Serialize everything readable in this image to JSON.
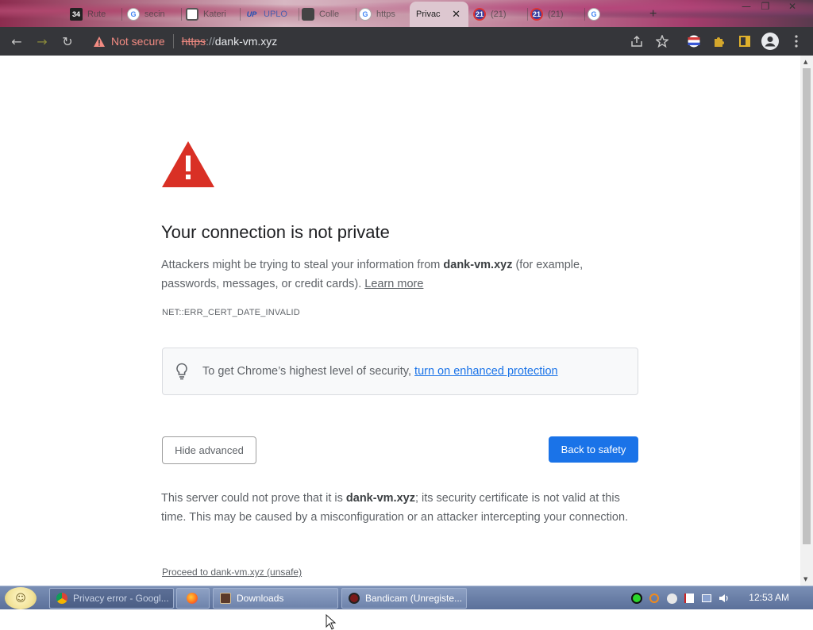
{
  "browser": {
    "tabs": [
      {
        "label": "Rute",
        "favicon_text": "34"
      },
      {
        "label": "secin",
        "favicon_text": "G"
      },
      {
        "label": "Kateri",
        "favicon_text": ""
      },
      {
        "label": "UPLO",
        "favicon_text": "UP"
      },
      {
        "label": "Colle",
        "favicon_text": ""
      },
      {
        "label": "https",
        "favicon_text": "G"
      },
      {
        "label": "(21)",
        "favicon_text": "21"
      },
      {
        "label": "(21)",
        "favicon_text": "21"
      },
      {
        "label": "",
        "favicon_text": "G"
      }
    ],
    "active_tab": {
      "label": "Privac",
      "close": "✕"
    },
    "new_tab": "+",
    "window_controls": {
      "minimize": "—",
      "maximize": "❐",
      "close": "✕"
    },
    "toolbar": {
      "back": "←",
      "forward": "→",
      "reload": "↻",
      "security_label": "Not secure",
      "url_scheme": "https",
      "url_separator": "://",
      "url_host": "dank-vm.xyz"
    },
    "icons": [
      "back-icon",
      "forward-icon",
      "reload-icon",
      "warning-icon",
      "share-icon",
      "star-icon",
      "flag-extension-icon",
      "puzzle-extensions-icon",
      "sidebar-icon",
      "profile-icon",
      "kebab-menu-icon"
    ]
  },
  "page": {
    "heading": "Your connection is not private",
    "desc_pre": "Attackers might be trying to steal your information from ",
    "desc_host": "dank-vm.xyz",
    "desc_post": " (for example, passwords, messages, or credit cards). ",
    "learn_more": "Learn more",
    "error_code": "NET::ERR_CERT_DATE_INVALID",
    "enhanced_text": "To get Chrome’s highest level of security, ",
    "enhanced_link": "turn on enhanced protection",
    "hide_advanced": "Hide advanced",
    "back_to_safety": "Back to safety",
    "details_pre": "This server could not prove that it is ",
    "details_host": "dank-vm.xyz",
    "details_post": "; its security certificate is not valid at this time. This may be caused by a misconfiguration or an attacker intercepting your connection.",
    "proceed": "Proceed to dank-vm.xyz (unsafe)",
    "colors": {
      "warning_red": "#d93025",
      "primary_blue": "#1a73e8",
      "text_gray": "#5f6368"
    }
  },
  "taskbar": {
    "start_icon": "smiley-start-icon",
    "tasks": [
      {
        "label": "Privacy error - Googl...",
        "icon": "chrome-icon",
        "active": true
      },
      {
        "label": "",
        "icon": "firefox-icon",
        "active": false
      },
      {
        "label": "Downloads",
        "icon": "folder-icon",
        "active": false
      },
      {
        "label": "Bandicam (Unregiste...",
        "icon": "bandicam-icon",
        "active": false
      }
    ],
    "tray_icons": [
      "green-status-icon",
      "search-tray-icon",
      "emoji-tray-icon",
      "flag-tray-icon",
      "network-icon",
      "volume-icon"
    ],
    "clock": "12:53 AM"
  }
}
